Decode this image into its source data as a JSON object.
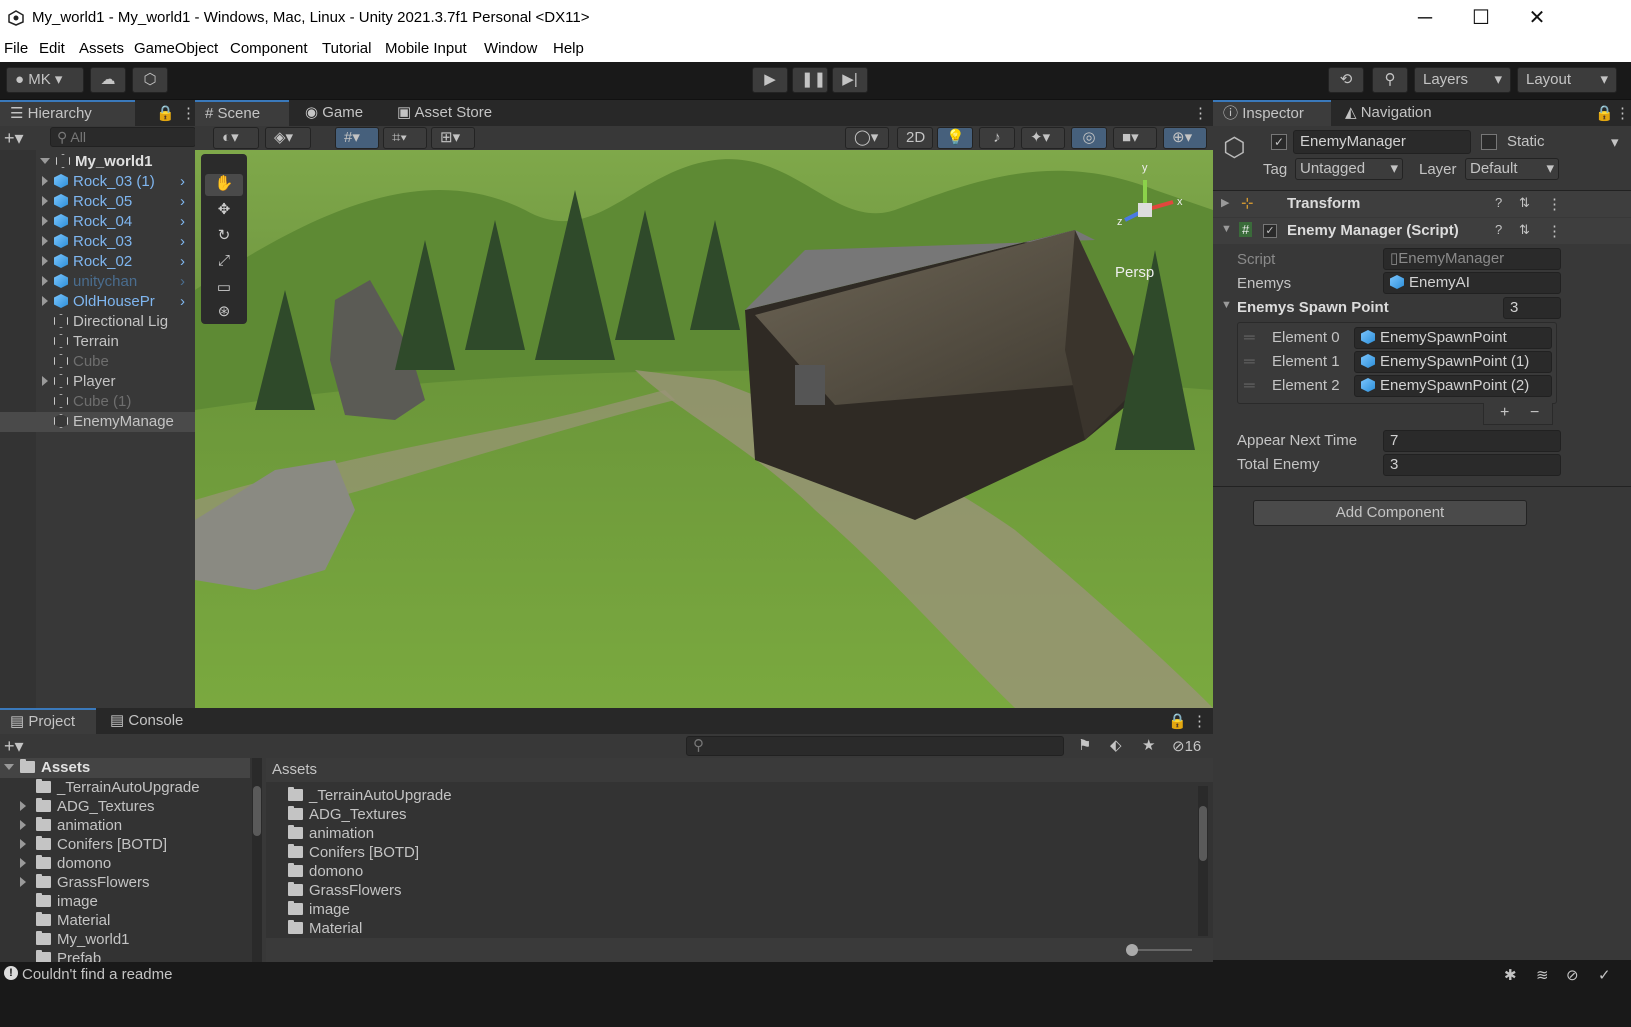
{
  "window": {
    "title": "My_world1 - My_world1 - Windows, Mac, Linux - Unity 2021.3.7f1 Personal <DX11>"
  },
  "menu": [
    "File",
    "Edit",
    "Assets",
    "GameObject",
    "Component",
    "Tutorial",
    "Mobile Input",
    "Window",
    "Help"
  ],
  "toolbar": {
    "account": "MK",
    "layers": "Layers",
    "layout": "Layout"
  },
  "hierarchy": {
    "tab": "Hierarchy",
    "search_placeholder": "All",
    "root": "My_world1",
    "items": [
      {
        "label": "Rock_03 (1)",
        "kind": "prefab"
      },
      {
        "label": "Rock_05",
        "kind": "prefab"
      },
      {
        "label": "Rock_04",
        "kind": "prefab"
      },
      {
        "label": "Rock_03",
        "kind": "prefab"
      },
      {
        "label": "Rock_02",
        "kind": "prefab"
      },
      {
        "label": "unitychan",
        "kind": "prefab-dim"
      },
      {
        "label": "OldHousePr",
        "kind": "prefab"
      },
      {
        "label": "Directional Lig",
        "kind": "object"
      },
      {
        "label": "Terrain",
        "kind": "object"
      },
      {
        "label": "Cube",
        "kind": "dim"
      },
      {
        "label": "Player",
        "kind": "object"
      },
      {
        "label": "Cube (1)",
        "kind": "dim"
      },
      {
        "label": "EnemyManage",
        "kind": "selected"
      }
    ]
  },
  "scene": {
    "tabs": [
      "Scene",
      "Game",
      "Asset Store"
    ],
    "persp": "Persp",
    "btn_2d": "2D",
    "gizmo_axes": [
      "y",
      "x",
      "z"
    ]
  },
  "inspector": {
    "tabs": [
      "Inspector",
      "Navigation"
    ],
    "name": "EnemyManager",
    "static": "Static",
    "tag_label": "Tag",
    "tag": "Untagged",
    "layer_label": "Layer",
    "layer": "Default",
    "transform": "Transform",
    "component": "Enemy Manager (Script)",
    "script_label": "Script",
    "script_value": "EnemyManager",
    "enemys_label": "Enemys",
    "enemys_value": "EnemyAI",
    "spawn_label": "Enemys Spawn Point",
    "spawn_count": "3",
    "elements": [
      {
        "label": "Element 0",
        "value": "EnemySpawnPoint"
      },
      {
        "label": "Element 1",
        "value": "EnemySpawnPoint (1)"
      },
      {
        "label": "Element 2",
        "value": "EnemySpawnPoint (2)"
      }
    ],
    "appear_label": "Appear Next Time",
    "appear_value": "7",
    "total_label": "Total Enemy",
    "total_value": "3",
    "add_component": "Add Component",
    "plus": "+",
    "minus": "−"
  },
  "project": {
    "tabs": [
      "Project",
      "Console"
    ],
    "root": "Assets",
    "count": "16",
    "breadcrumb": "Assets",
    "tree": [
      "_TerrainAutoUpgrade",
      "ADG_Textures",
      "animation",
      "Conifers [BOTD]",
      "domono",
      "GrassFlowers",
      "image",
      "Material",
      "My_world1",
      "Prefab"
    ],
    "tree_expandable": [
      false,
      true,
      true,
      true,
      true,
      true,
      false,
      false,
      false,
      false
    ],
    "files": [
      "_TerrainAutoUpgrade",
      "ADG_Textures",
      "animation",
      "Conifers [BOTD]",
      "domono",
      "GrassFlowers",
      "image",
      "Material"
    ]
  },
  "status": {
    "message": "Couldn't find a readme"
  }
}
